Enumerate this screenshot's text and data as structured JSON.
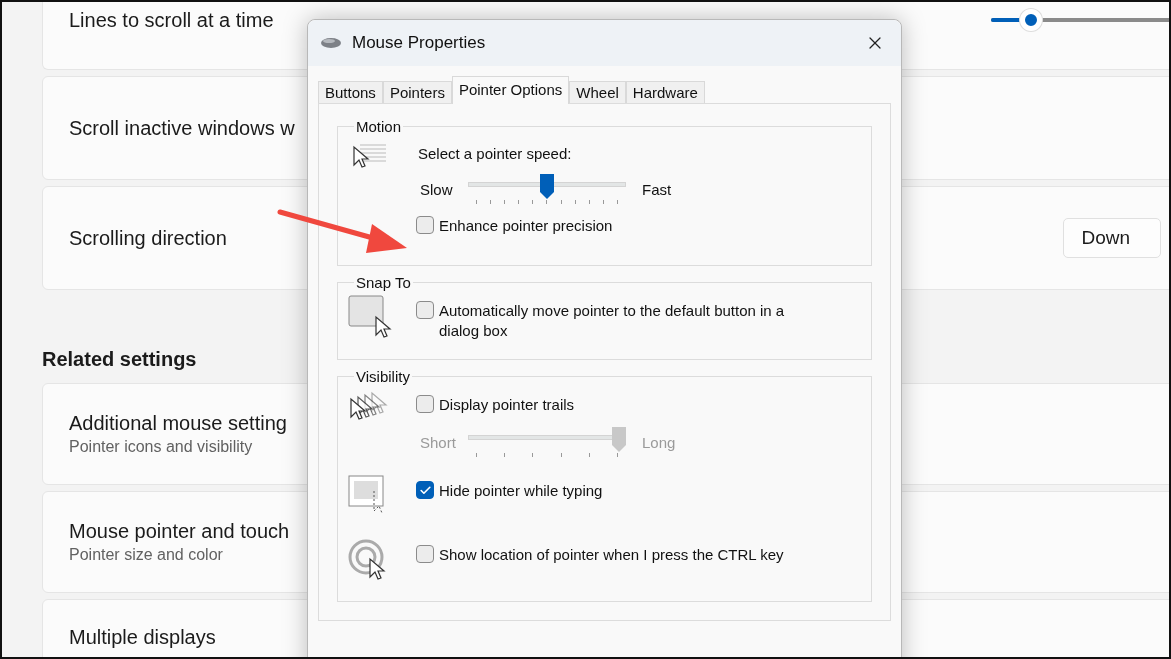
{
  "settings": {
    "cards": [
      {
        "kind": "slider",
        "title": "Lines to scroll at a time",
        "level": 0.2
      },
      {
        "kind": "plain",
        "title": "Scroll inactive windows w"
      },
      {
        "kind": "dropdown",
        "title": "Scrolling direction",
        "value": "Down"
      }
    ],
    "related_heading": "Related settings",
    "related": [
      {
        "title": "Additional mouse setting",
        "subtitle": "Pointer icons and visibility"
      },
      {
        "title": "Mouse pointer and touch",
        "subtitle": "Pointer size and color"
      },
      {
        "title": "Multiple displays"
      }
    ]
  },
  "dialog": {
    "title": "Mouse Properties",
    "tabs": [
      {
        "label": "Buttons",
        "selected": false
      },
      {
        "label": "Pointers",
        "selected": false
      },
      {
        "label": "Pointer Options",
        "selected": true
      },
      {
        "label": "Wheel",
        "selected": false
      },
      {
        "label": "Hardware",
        "selected": false
      }
    ],
    "groups": [
      {
        "title": "Motion",
        "rows": [
          {
            "kind": "speed",
            "items": [
              {
                "kind": "label",
                "text": "Select a pointer speed:"
              },
              {
                "kind": "slider",
                "min_label": "Slow",
                "max_label": "Fast",
                "level": 0.5,
                "disabled": false
              },
              {
                "kind": "checkbox",
                "label": "Enhance pointer precision",
                "checked": false
              }
            ]
          }
        ]
      },
      {
        "title": "Snap To",
        "rows": [
          {
            "kind": "snap",
            "items": [
              {
                "kind": "checkbox",
                "label": "Automatically move pointer to the default button in a dialog box",
                "checked": false
              }
            ]
          }
        ]
      },
      {
        "title": "Visibility",
        "rows": [
          {
            "kind": "trails",
            "items": [
              {
                "kind": "checkbox",
                "label": "Display pointer trails",
                "checked": false
              },
              {
                "kind": "slider",
                "min_label": "Short",
                "max_label": "Long",
                "level": 1,
                "disabled": true
              }
            ]
          },
          {
            "kind": "hide",
            "items": [
              {
                "kind": "checkbox",
                "label": "Hide pointer while typing",
                "checked": true
              }
            ]
          },
          {
            "kind": "locate",
            "items": [
              {
                "kind": "checkbox",
                "label": "Show location of pointer when I press the CTRL key",
                "checked": false
              }
            ]
          }
        ]
      }
    ]
  }
}
